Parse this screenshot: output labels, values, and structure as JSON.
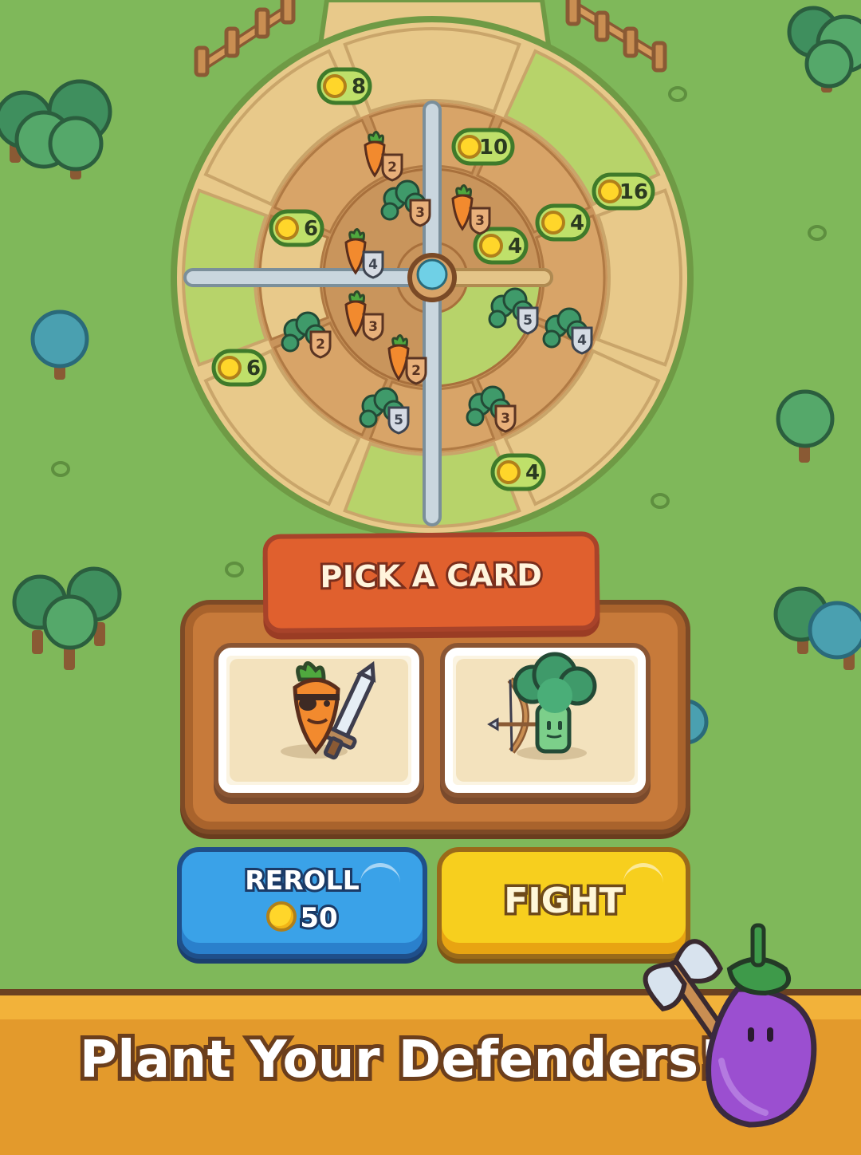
{
  "scene": {
    "colors": {
      "grass": "#7fb85a",
      "path": "#e8c98a",
      "soil": "#c9955c",
      "banner_orange": "#e0602e",
      "button_blue": "#3aa2e8",
      "button_yellow": "#f7cf1e",
      "bottom_banner": "#e39a2c"
    }
  },
  "plots": {
    "coin_prices": [
      "8",
      "10",
      "16",
      "6",
      "4",
      "4",
      "6",
      "4"
    ],
    "units": [
      {
        "type": "carrot",
        "level": "2"
      },
      {
        "type": "broccoli",
        "level": "3"
      },
      {
        "type": "carrot",
        "level": "3"
      },
      {
        "type": "carrot",
        "level": "4"
      },
      {
        "type": "broccoli",
        "level": "5"
      },
      {
        "type": "broccoli",
        "level": "4"
      },
      {
        "type": "carrot",
        "level": "3"
      },
      {
        "type": "broccoli",
        "level": "2"
      },
      {
        "type": "carrot",
        "level": "2"
      },
      {
        "type": "broccoli",
        "level": "5"
      },
      {
        "type": "broccoli",
        "level": "3"
      }
    ]
  },
  "pick_card": {
    "title": "PICK A CARD",
    "cards": [
      {
        "name": "carrot-swordsman",
        "icon": "carrot-with-sword-icon"
      },
      {
        "name": "broccoli-archer",
        "icon": "broccoli-with-bow-icon"
      }
    ]
  },
  "actions": {
    "reroll_label": "REROLL",
    "reroll_cost": "50",
    "fight_label": "FIGHT"
  },
  "banner": {
    "tagline": "Plant Your Defenders!",
    "mascot": "eggplant-with-axe-icon"
  }
}
